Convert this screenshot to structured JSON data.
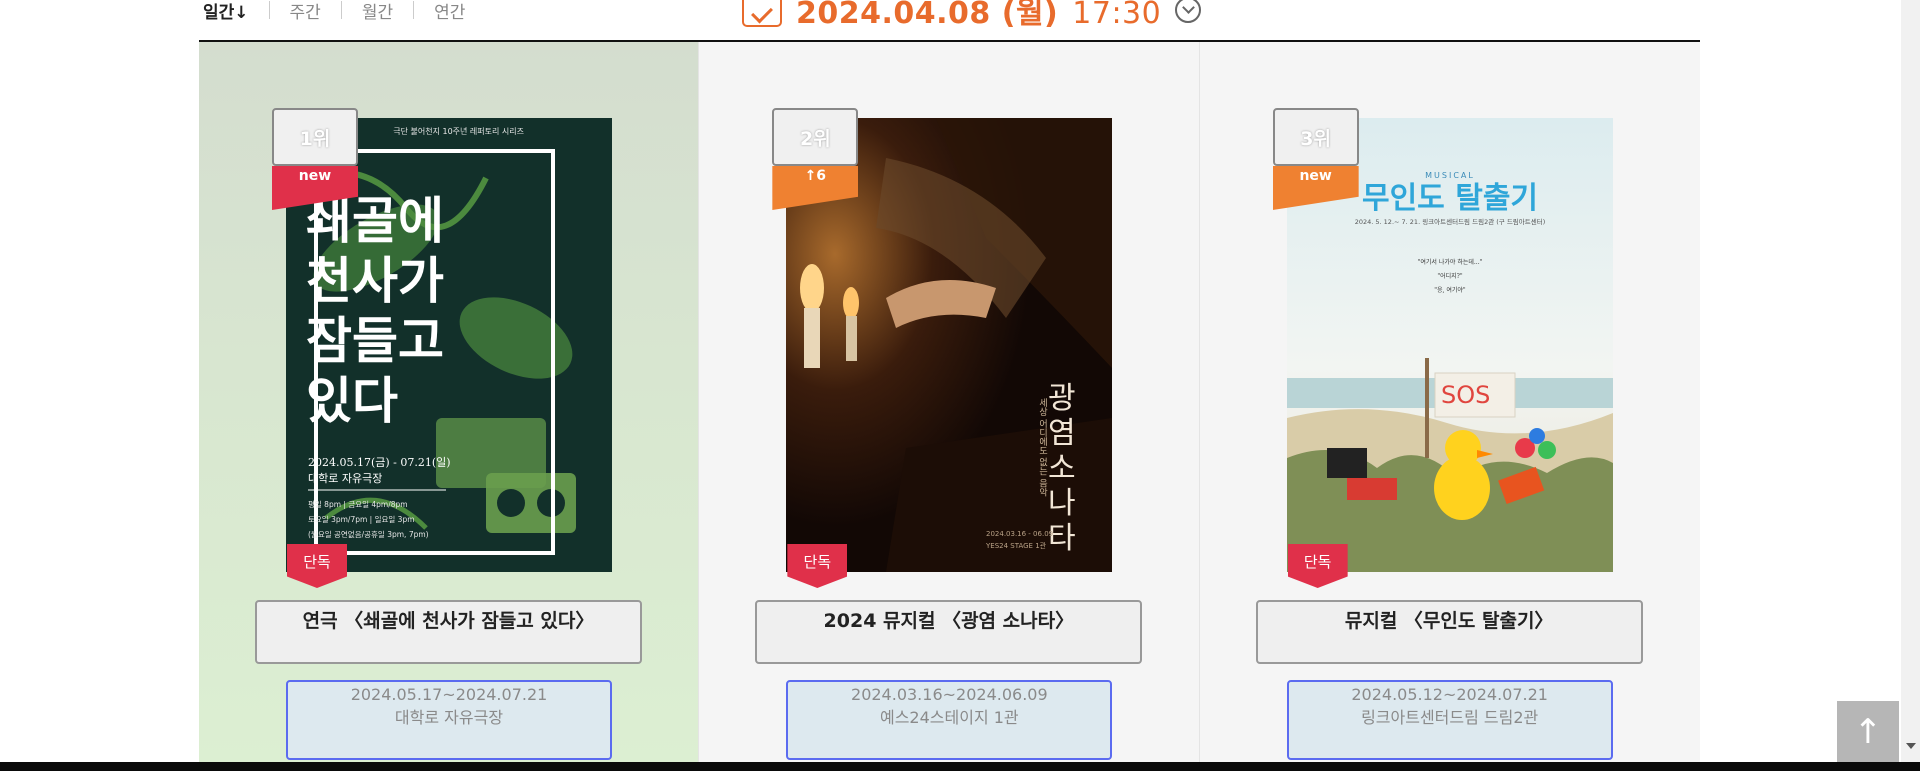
{
  "period_tabs": [
    "일간↓",
    "주간",
    "월간",
    "연간"
  ],
  "date": {
    "text": "2024.04.08 (월)",
    "time": "17:30"
  },
  "to_top_label": "↑",
  "colors": {
    "accent": "#e86b2c",
    "rank_new": "#e0304a",
    "rank_up": "#ef8131",
    "info_border": "#5b6bf0"
  },
  "cards": [
    {
      "rank": "1위",
      "badge": "new",
      "exclusive": "단독",
      "title": "연극 〈쇄골에 천사가 잠들고 있다〉",
      "period": "2024.05.17~2024.07.21",
      "venue": "대학로 자유극장",
      "poster": {
        "top_caption": "극단 불어천지 10주년 레퍼토리 시리즈",
        "title_lines": [
          "쇄골에",
          "천사가",
          "잠들고",
          "있다"
        ],
        "date_line": "2024.05.17(금) - 07.21(일)",
        "venue_line": "대학로 자유극장",
        "time_lines": [
          "평일 8pm | 금요일 4pm/8pm",
          "토요일 3pm/7pm | 일요일 3pm",
          "(월요일 공연없음/공휴일 3pm, 7pm)"
        ]
      }
    },
    {
      "rank": "2위",
      "badge": "↑6",
      "exclusive": "단독",
      "title": "2024 뮤지컬 〈광염 소나타〉",
      "period": "2024.03.16~2024.06.09",
      "venue": "예스24스테이지 1관",
      "poster": {
        "tagline": "세상 어디에도 없는 음악",
        "title_chars": [
          "광",
          "염",
          "소",
          "나",
          "타"
        ],
        "date_line": "2024.03.16 - 06.09",
        "venue_line": "YES24 STAGE 1관"
      }
    },
    {
      "rank": "3위",
      "badge": "new",
      "exclusive": "단독",
      "title": "뮤지컬 〈무인도 탈출기〉",
      "period": "2024.05.12~2024.07.21",
      "venue": "링크아트센터드림 드림2관",
      "poster": {
        "kicker": "MUSICAL",
        "title": "무인도 탈출기",
        "date_line": "2024. 5. 12.~ 7. 21. 링크아트센터드림 드림2관 (구 드림아트센터)",
        "quote_lines": [
          "\"여기서 나가야 하는데...\"",
          "\"어디지?\"",
          "\"응, 여기야\""
        ],
        "sign_text": "SOS"
      }
    }
  ]
}
